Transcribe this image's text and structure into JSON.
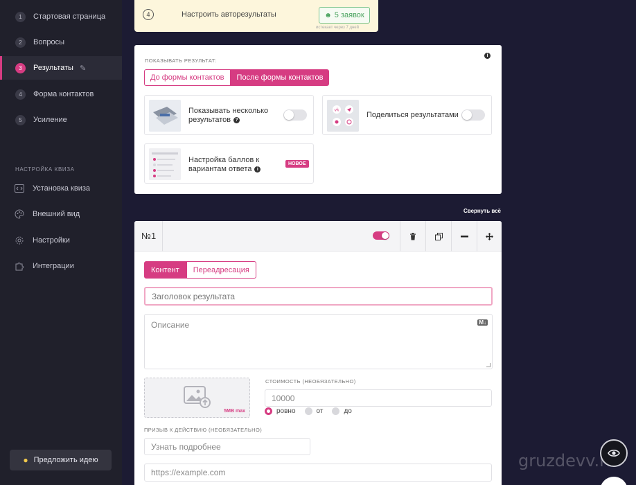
{
  "sidebar": {
    "steps": [
      {
        "num": "1",
        "label": "Стартовая страница"
      },
      {
        "num": "2",
        "label": "Вопросы"
      },
      {
        "num": "3",
        "label": "Результаты"
      },
      {
        "num": "4",
        "label": "Форма контактов"
      },
      {
        "num": "5",
        "label": "Усиление"
      }
    ],
    "section_title": "Настройка квиза",
    "menu": [
      {
        "label": "Установка квиза",
        "icon": "code-icon"
      },
      {
        "label": "Внешний вид",
        "icon": "palette-icon"
      },
      {
        "label": "Настройки",
        "icon": "gear-icon"
      },
      {
        "label": "Интеграции",
        "icon": "puzzle-icon"
      }
    ],
    "idea_button": "Предложить идею"
  },
  "notice": {
    "step": "4",
    "text": "Настроить авторезультаты",
    "button": "5 заявок",
    "sub": "истекает через 7 дней"
  },
  "result_settings": {
    "label": "Показывать результат:",
    "tab_before": "До формы контактов",
    "tab_after": "После формы контактов",
    "option_multiple": "Показывать несколько результатов",
    "option_share": "Поделиться результатами",
    "option_points": "Настройка баллов к вариантам ответа",
    "badge_new": "НОВОЕ"
  },
  "collapse_all": "Свернуть всё",
  "result_card": {
    "number": "№1",
    "enabled": true,
    "tab_content": "Контент",
    "tab_redirect": "Переадресация",
    "title_placeholder": "Заголовок результата",
    "description_placeholder": "Описание",
    "upload_max": "5MB max",
    "price_label": "Стоимость (необязательно)",
    "price_value": "10000",
    "price_modes": [
      "ровно",
      "от",
      "до"
    ],
    "price_mode_selected": "ровно",
    "cta_label": "Призыв к действию (необязательно)",
    "cta_placeholder": "Узнать подробнее",
    "url_placeholder": "https://example.com"
  },
  "watermark": "gruzdevv.ru",
  "colors": {
    "accent": "#d63c82",
    "sidebar": "#20202b",
    "background": "#1c1b33",
    "notice": "#fdf6dc",
    "success": "#4aa35e"
  }
}
